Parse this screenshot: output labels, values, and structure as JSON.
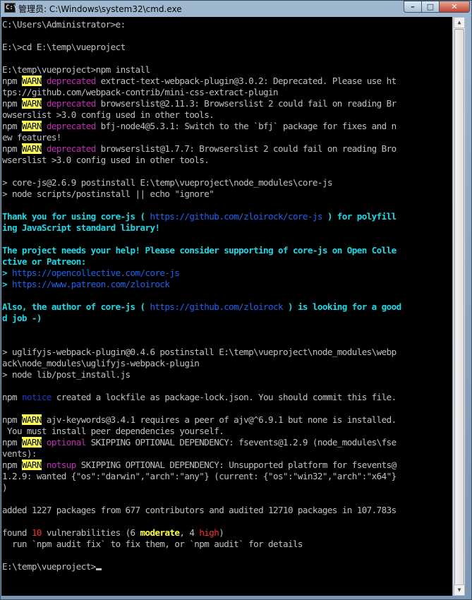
{
  "window": {
    "title": "管理员: C:\\Windows\\system32\\cmd.exe",
    "icon_text": "C:\\",
    "buttons": {
      "minimize": "–",
      "maximize": "□",
      "close": "✕"
    }
  },
  "scrollbar": {
    "up_arrow": "▲",
    "down_arrow": "▼"
  },
  "terminal": {
    "lines": [
      [
        {
          "t": "C:\\Users\\Administrator>e:"
        }
      ],
      [],
      [
        {
          "t": "E:\\>cd E:\\temp\\vueproject"
        }
      ],
      [],
      [
        {
          "t": "E:\\temp\\vueproject>npm install"
        }
      ],
      [
        {
          "t": "npm "
        },
        {
          "t": "WARN",
          "c": "warn"
        },
        {
          "t": " "
        },
        {
          "t": "deprecated",
          "c": "mag"
        },
        {
          "t": " extract-text-webpack-plugin@3.0.2: Deprecated. Please use ht"
        }
      ],
      [
        {
          "t": "tps://github.com/webpack-contrib/mini-css-extract-plugin"
        }
      ],
      [
        {
          "t": "npm "
        },
        {
          "t": "WARN",
          "c": "warn"
        },
        {
          "t": " "
        },
        {
          "t": "deprecated",
          "c": "mag"
        },
        {
          "t": " browserslist@2.11.3: Browserslist 2 could fail on reading Br"
        }
      ],
      [
        {
          "t": "owserslist >3.0 config used in other tools."
        }
      ],
      [
        {
          "t": "npm "
        },
        {
          "t": "WARN",
          "c": "warn"
        },
        {
          "t": " "
        },
        {
          "t": "deprecated",
          "c": "mag"
        },
        {
          "t": " bfj-node4@5.3.1: Switch to the `bfj` package for fixes and n"
        }
      ],
      [
        {
          "t": "ew features!"
        }
      ],
      [
        {
          "t": "npm "
        },
        {
          "t": "WARN",
          "c": "warn"
        },
        {
          "t": " "
        },
        {
          "t": "deprecated",
          "c": "mag"
        },
        {
          "t": " browserslist@1.7.7: Browserslist 2 could fail on reading Bro"
        }
      ],
      [
        {
          "t": "wserslist >3.0 config used in other tools."
        }
      ],
      [],
      [
        {
          "t": "> core-js@2.6.9 postinstall E:\\temp\\vueproject\\node_modules\\core-js"
        }
      ],
      [
        {
          "t": "> node scripts/postinstall || echo \"ignore\""
        }
      ],
      [],
      [
        {
          "t": "Thank you for using core-js ( ",
          "c": "cyan"
        },
        {
          "t": "https://github.com/zloirock/core-js",
          "c": "link"
        },
        {
          "t": " ) for polyfill",
          "c": "cyan"
        }
      ],
      [
        {
          "t": "ing JavaScript standard library!",
          "c": "cyan"
        }
      ],
      [],
      [
        {
          "t": "The project needs your help! Please consider supporting of core-js on Open Colle",
          "c": "cyan"
        }
      ],
      [
        {
          "t": "ctive or Patreon:",
          "c": "cyan"
        }
      ],
      [
        {
          "t": "> ",
          "c": "cyan"
        },
        {
          "t": "https://opencollective.com/core-js",
          "c": "link"
        }
      ],
      [
        {
          "t": "> ",
          "c": "cyan"
        },
        {
          "t": "https://www.patreon.com/zloirock",
          "c": "link"
        }
      ],
      [],
      [
        {
          "t": "Also, the author of core-js ( ",
          "c": "cyan"
        },
        {
          "t": "https://github.com/zloirock",
          "c": "link"
        },
        {
          "t": " ) is looking for a good",
          "c": "cyan"
        }
      ],
      [
        {
          "t": "d job -)",
          "c": "cyan"
        }
      ],
      [],
      [],
      [
        {
          "t": "> uglifyjs-webpack-plugin@0.4.6 postinstall E:\\temp\\vueproject\\node_modules\\webp"
        }
      ],
      [
        {
          "t": "ack\\node_modules\\uglifyjs-webpack-plugin"
        }
      ],
      [
        {
          "t": "> node lib/post_install.js"
        }
      ],
      [],
      [
        {
          "t": "npm "
        },
        {
          "t": "notice",
          "c": "blue"
        },
        {
          "t": " created a lockfile as package-lock.json. You should commit this file."
        }
      ],
      [],
      [
        {
          "t": "npm "
        },
        {
          "t": "WARN",
          "c": "warn"
        },
        {
          "t": " ajv-keywords@3.4.1 requires a peer of ajv@^6.9.1 but none is installed."
        }
      ],
      [
        {
          "t": " You must install peer dependencies yourself."
        }
      ],
      [
        {
          "t": "npm "
        },
        {
          "t": "WARN",
          "c": "warn"
        },
        {
          "t": " "
        },
        {
          "t": "optional",
          "c": "mag"
        },
        {
          "t": " SKIPPING OPTIONAL DEPENDENCY: fsevents@1.2.9 (node_modules\\fse"
        }
      ],
      [
        {
          "t": "vents):"
        }
      ],
      [
        {
          "t": "npm "
        },
        {
          "t": "WARN",
          "c": "warn"
        },
        {
          "t": " "
        },
        {
          "t": "notsup",
          "c": "mag"
        },
        {
          "t": " SKIPPING OPTIONAL DEPENDENCY: Unsupported platform for fsevents@"
        }
      ],
      [
        {
          "t": "1.2.9: wanted {\"os\":\"darwin\",\"arch\":\"any\"} (current: {\"os\":\"win32\",\"arch\":\"x64\"}"
        }
      ],
      [
        {
          "t": ")"
        }
      ],
      [],
      [
        {
          "t": "added 1227 packages from 677 contributors and audited 12710 packages in 107.783s"
        }
      ],
      [],
      [
        {
          "t": "found "
        },
        {
          "t": "10",
          "c": "red"
        },
        {
          "t": " vulnerabilities (6 "
        },
        {
          "t": "moderate",
          "c": "yellow"
        },
        {
          "t": ", 4 "
        },
        {
          "t": "high",
          "c": "red"
        },
        {
          "t": ")"
        }
      ],
      [
        {
          "t": "  run `npm audit fix` to fix them, or `npm audit` for details"
        }
      ],
      [],
      [
        {
          "t": "E:\\temp\\vueproject>"
        }
      ]
    ]
  }
}
